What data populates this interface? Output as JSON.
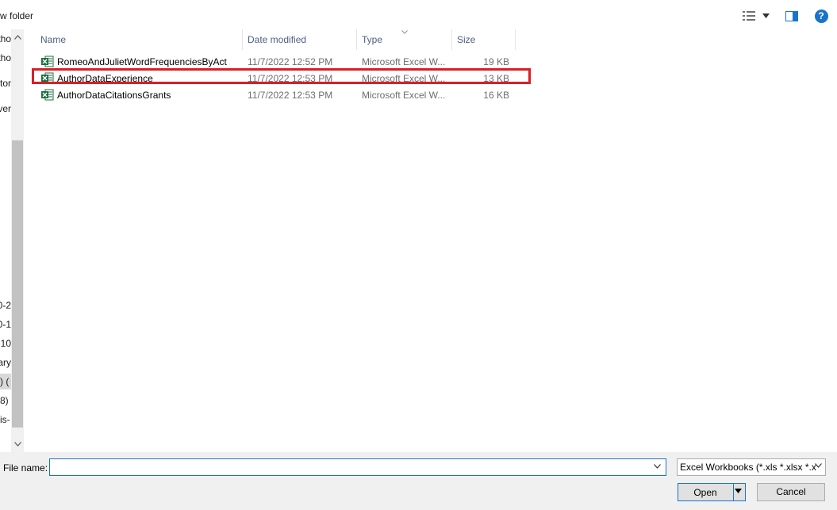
{
  "toolbar": {
    "new_folder_label": "w folder",
    "view_icon": "view-details-icon",
    "preview_icon": "preview-pane-icon",
    "help_label": "?"
  },
  "nav": {
    "items": [
      "tho",
      "tho",
      "tor",
      "ver",
      "0-2",
      "0-1",
      "-10",
      "rary",
      ") (",
      "8)",
      "is-"
    ],
    "selected_index": 8
  },
  "columns": {
    "name": "Name",
    "date_modified": "Date modified",
    "type": "Type",
    "size": "Size"
  },
  "files": [
    {
      "name": "RomeoAndJulietWordFrequenciesByAct",
      "date": "11/7/2022 12:52 PM",
      "type": "Microsoft Excel W...",
      "size": "19 KB"
    },
    {
      "name": "AuthorDataExperience",
      "date": "11/7/2022 12:53 PM",
      "type": "Microsoft Excel W...",
      "size": "13 KB"
    },
    {
      "name": "AuthorDataCitationsGrants",
      "date": "11/7/2022 12:53 PM",
      "type": "Microsoft Excel W...",
      "size": "16 KB"
    }
  ],
  "bottom": {
    "file_name_label": "File name:",
    "file_name_value": "",
    "filter_value": "Excel Workbooks (*.xls *.xlsx *.x",
    "open_label": "Open",
    "cancel_label": "Cancel"
  },
  "colors": {
    "accent": "#1a73c9",
    "highlight": "#d81f26",
    "excel_green": "#1d6f42"
  }
}
